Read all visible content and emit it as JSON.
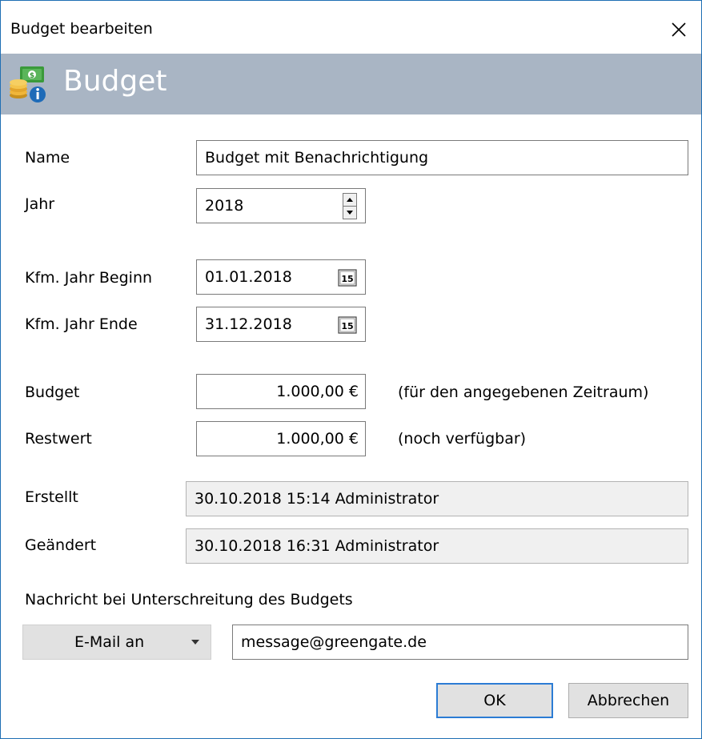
{
  "window": {
    "title": "Budget bearbeiten"
  },
  "header": {
    "title": "Budget",
    "icon": "budget-money-info-icon"
  },
  "form": {
    "name": {
      "label": "Name",
      "value": "Budget mit Benachrichtigung"
    },
    "jahr": {
      "label": "Jahr",
      "value": "2018"
    },
    "kfm_beginn": {
      "label": "Kfm. Jahr Beginn",
      "value": "01.01.2018"
    },
    "kfm_ende": {
      "label": "Kfm. Jahr Ende",
      "value": "31.12.2018"
    },
    "budget": {
      "label": "Budget",
      "value": "1.000,00 €",
      "note": "(für den angegebenen Zeitraum)"
    },
    "restwert": {
      "label": "Restwert",
      "value": "1.000,00 €",
      "note": "(noch verfügbar)"
    },
    "erstellt": {
      "label": "Erstellt",
      "value": "30.10.2018 15:14 Administrator"
    },
    "geaendert": {
      "label": "Geändert",
      "value": "30.10.2018 16:31 Administrator"
    },
    "calendar_icon_text": "15"
  },
  "notification": {
    "label": "Nachricht bei Unterschreitung des Budgets",
    "dropdown_value": "E-Mail an",
    "email": "message@greengate.de"
  },
  "buttons": {
    "ok": "OK",
    "cancel": "Abbrechen"
  },
  "colors": {
    "header_band": "#a9b5c4",
    "window_border": "#1f6fb4",
    "default_button_border": "#2c7cd4"
  }
}
